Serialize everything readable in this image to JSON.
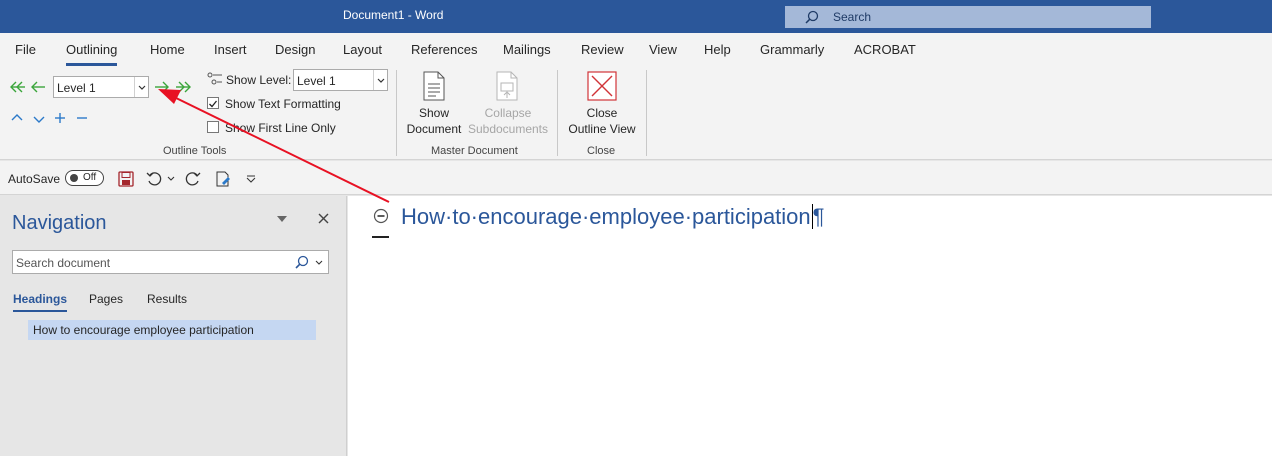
{
  "window": {
    "title": "Document1  -  Word",
    "search_label": "Search"
  },
  "menu": {
    "tabs": [
      "File",
      "Outlining",
      "Home",
      "Insert",
      "Design",
      "Layout",
      "References",
      "Mailings",
      "Review",
      "View",
      "Help",
      "Grammarly",
      "ACROBAT"
    ],
    "active": "Outlining"
  },
  "ribbon": {
    "outline_tools": {
      "level_value": "Level 1",
      "show_level_label": "Show Level:",
      "show_level_value": "Level 1",
      "show_text_formatting_label": "Show Text Formatting",
      "show_text_formatting_checked": true,
      "show_first_line_label": "Show First Line Only",
      "show_first_line_checked": false,
      "group_label": "Outline Tools"
    },
    "master_document": {
      "show_document_line1": "Show",
      "show_document_line2": "Document",
      "collapse_line1": "Collapse",
      "collapse_line2": "Subdocuments",
      "group_label": "Master Document"
    },
    "close": {
      "close_line1": "Close",
      "close_line2": "Outline View",
      "group_label": "Close"
    }
  },
  "qat": {
    "autosave_label": "AutoSave",
    "autosave_state": "Off"
  },
  "navigation": {
    "title": "Navigation",
    "search_placeholder": "Search document",
    "tabs": [
      "Headings",
      "Pages",
      "Results"
    ],
    "active_tab": "Headings",
    "headings": [
      "How to encourage employee participation"
    ]
  },
  "document": {
    "heading_text": "How·to·encourage·employee·participation",
    "pilcrow": "¶"
  },
  "colors": {
    "brand": "#2b579a",
    "arrow": "#e81123",
    "promote": "#3aa53a"
  },
  "icons": [
    "search-icon",
    "promote-to-heading-icon",
    "promote-icon",
    "demote-icon",
    "demote-to-body-icon",
    "move-up-icon",
    "move-down-icon",
    "expand-icon",
    "collapse-icon",
    "show-document-icon",
    "collapse-subdocuments-icon",
    "close-outline-view-icon",
    "save-icon",
    "undo-icon",
    "redo-icon",
    "touch-mode-icon",
    "customize-qat-icon"
  ]
}
